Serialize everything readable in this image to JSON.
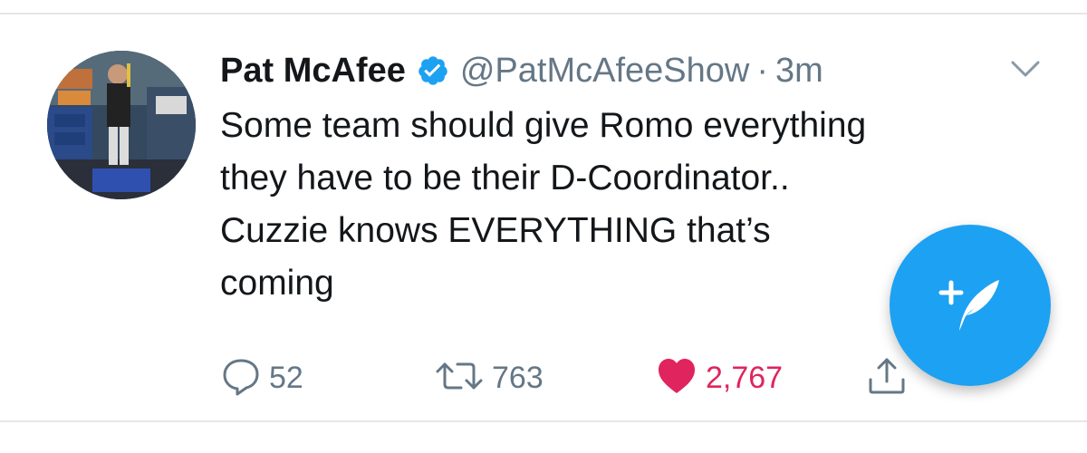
{
  "tweet": {
    "display_name": "Pat McAfee",
    "handle": "@PatMcAfeeShow",
    "separator": "·",
    "time": "3m",
    "text_lines": [
      "Some team should give Romo everything",
      "they have to be their D-Coordinator..",
      "Cuzzie knows EVERYTHING that’s",
      "coming"
    ],
    "verified": true
  },
  "actions": {
    "reply_count": "52",
    "retweet_count": "763",
    "like_count": "2,767",
    "liked": true
  },
  "icons": {
    "verified": "verified-badge-icon",
    "caret": "chevron-down-icon",
    "reply": "reply-icon",
    "retweet": "retweet-icon",
    "like": "heart-icon",
    "share": "share-icon",
    "compose": "compose-tweet-icon"
  },
  "colors": {
    "brand_blue": "#1da1f2",
    "like_red": "#e0245e",
    "secondary_text": "#657786",
    "primary_text": "#14171a"
  }
}
